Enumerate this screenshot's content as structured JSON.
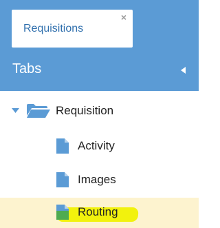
{
  "doc_tab": {
    "label": "Requisitions",
    "close_glyph": "×"
  },
  "panel": {
    "title": "Tabs",
    "collapse_icon": "caret-left-icon"
  },
  "tree": {
    "root": {
      "label": "Requisition",
      "expanded": true,
      "icon": "folder-open-icon"
    },
    "children": [
      {
        "label": "Activity",
        "icon": "file-icon",
        "selected": false
      },
      {
        "label": "Images",
        "icon": "file-icon",
        "selected": false
      },
      {
        "label": "Routing",
        "icon": "file-icon",
        "selected": true
      }
    ]
  },
  "colors": {
    "header_bg": "#5b9bd5",
    "icon_blue": "#5b9bd5",
    "selected_row_bg": "#fdf3cf",
    "highlighter": "#f2f20d"
  }
}
